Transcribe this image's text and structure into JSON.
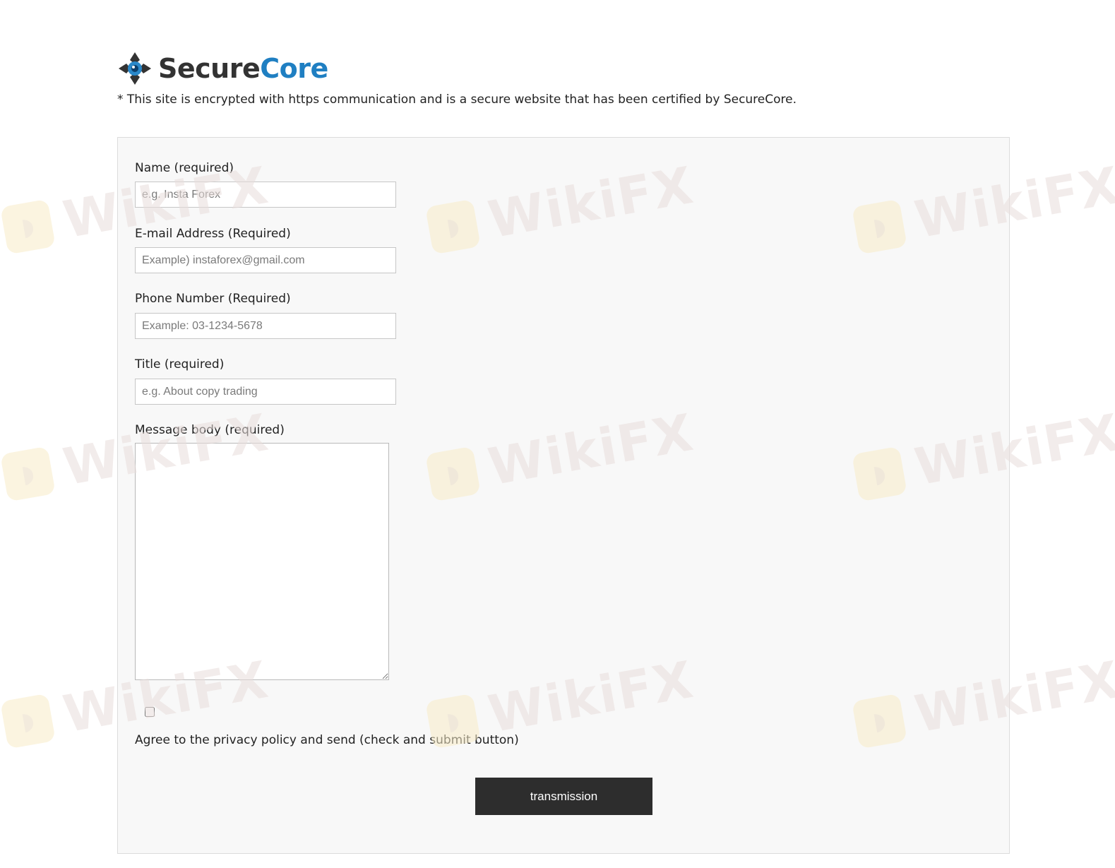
{
  "brand": {
    "name_part1": "Secure",
    "name_part2": "Core",
    "primary_color": "#1f7fc2",
    "dark_color": "#333333"
  },
  "notice": "* This site is encrypted with https communication and is a secure website that has been certified by SecureCore.",
  "form": {
    "name": {
      "label": "Name (required)",
      "placeholder": "e.g. Insta Forex",
      "value": ""
    },
    "email": {
      "label": "E-mail Address (Required)",
      "placeholder": "Example) instaforex@gmail.com",
      "value": ""
    },
    "phone": {
      "label": "Phone Number (Required)",
      "placeholder": "Example: 03-1234-5678",
      "value": ""
    },
    "title": {
      "label": "Title (required)",
      "placeholder": "e.g. About copy trading",
      "value": ""
    },
    "message": {
      "label": "Message body (required)",
      "value": ""
    },
    "agree": {
      "label": "Agree to the privacy policy and send (check and submit button)",
      "checked": false
    },
    "submit_label": "transmission"
  },
  "watermark": {
    "text": "WikiFX",
    "text_color": "#e9dedc",
    "badge_color": "#f8ecc8"
  }
}
